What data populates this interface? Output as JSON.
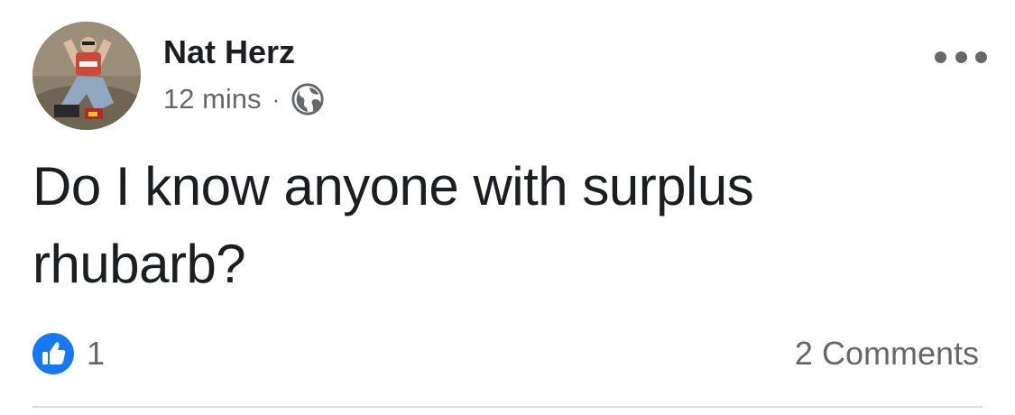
{
  "post": {
    "author": "Nat Herz",
    "timestamp": "12 mins",
    "separator": "·",
    "audience_icon": "globe-icon",
    "more_icon": "more-options-icon",
    "text": "Do I know anyone with surplus rhubarb?"
  },
  "footer": {
    "reaction_icon": "like-icon",
    "reaction_count": "1",
    "comments_label": "2 Comments"
  },
  "colors": {
    "text": "#1c1e21",
    "secondary": "#65676b",
    "like_blue": "#1877f2",
    "divider": "#dadde1"
  }
}
